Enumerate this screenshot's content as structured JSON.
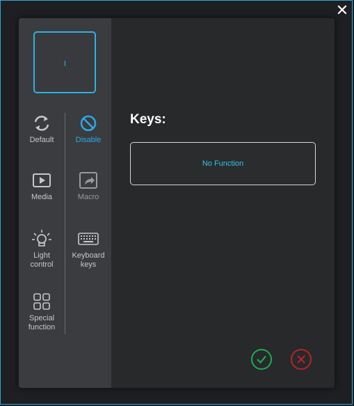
{
  "window": {
    "close_symbol": "✕"
  },
  "key_preview": {
    "value": ""
  },
  "categories": [
    {
      "label": "Default",
      "icon": "refresh-icon",
      "state": "normal"
    },
    {
      "label": "Disable",
      "icon": "disable-icon",
      "state": "active"
    },
    {
      "label": "Media",
      "icon": "play-icon",
      "state": "normal"
    },
    {
      "label": "Macro",
      "icon": "macro-icon",
      "state": "dim"
    },
    {
      "label_line1": "Light",
      "label_line2": "control",
      "icon": "bulb-icon",
      "state": "normal"
    },
    {
      "label_line1": "Keyboard",
      "label_line2": "keys",
      "icon": "keyboard-icon",
      "state": "normal"
    },
    {
      "label_line1": "Special",
      "label_line2": "function",
      "icon": "grid-icon",
      "state": "normal"
    }
  ],
  "main": {
    "keys_title": "Keys:",
    "keys_value": "No Function"
  },
  "colors": {
    "accent": "#2fa8e6",
    "confirm": "#1faa52",
    "cancel": "#b6232a"
  }
}
